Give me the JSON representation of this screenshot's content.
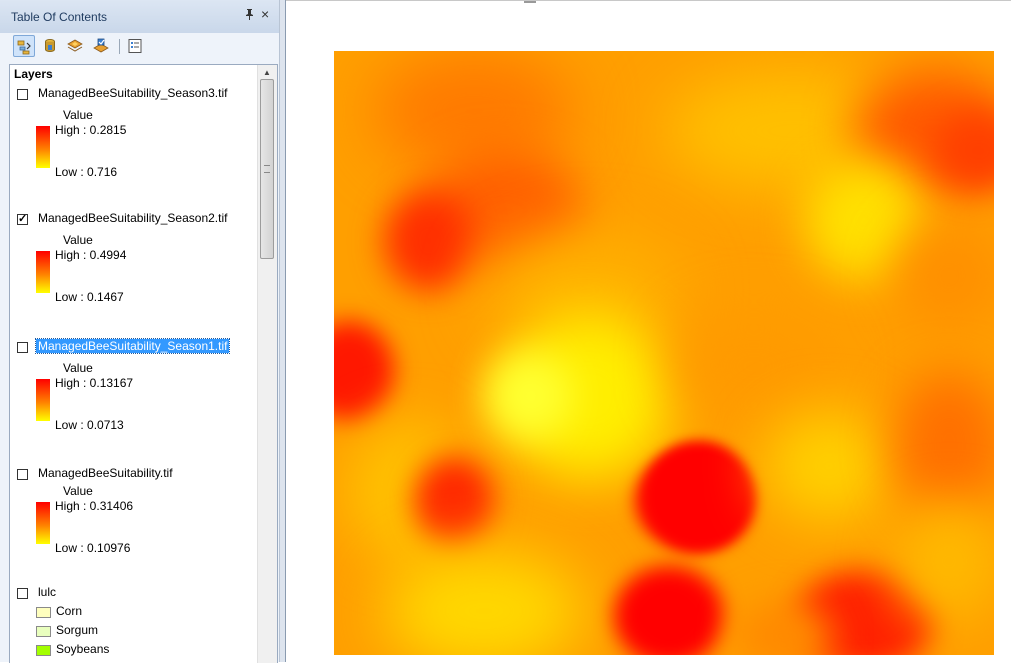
{
  "toc": {
    "title": "Table Of Contents",
    "pin_glyph": "ᵖ",
    "close_glyph": "×",
    "toolbar": [
      {
        "name": "list-by-drawing-order-icon",
        "active": true
      },
      {
        "name": "list-by-source-icon",
        "active": false
      },
      {
        "name": "list-by-visibility-icon",
        "active": false
      },
      {
        "name": "list-by-selection-icon",
        "active": false
      },
      {
        "name": "options-icon",
        "active": false
      }
    ],
    "root_label": "Layers",
    "layers": [
      {
        "name": "ManagedBeeSuitability_Season3.tif",
        "checked": false,
        "selected": false,
        "value_label": "Value",
        "high": "High : 0.2815",
        "low": "Low : 0.716"
      },
      {
        "name": "ManagedBeeSuitability_Season2.tif",
        "checked": true,
        "selected": false,
        "value_label": "Value",
        "high": "High : 0.4994",
        "low": "Low : 0.1467"
      },
      {
        "name": "ManagedBeeSuitability_Season1.tif",
        "checked": false,
        "selected": true,
        "value_label": "Value",
        "high": "High : 0.13167",
        "low": "Low : 0.0713"
      },
      {
        "name": "ManagedBeeSuitability.tif",
        "checked": false,
        "selected": false,
        "value_label": "Value",
        "high": "High : 0.31406",
        "low": "Low : 0.10976"
      }
    ],
    "lulc": {
      "name": "lulc",
      "checked": false,
      "classes": [
        {
          "label": "Corn",
          "color": "#ffffbe"
        },
        {
          "label": "Sorgum",
          "color": "#e9ffbe"
        },
        {
          "label": "Soybeans",
          "color": "#a3ff00"
        }
      ]
    }
  },
  "colors": {
    "ramp_high": "#ff0000",
    "ramp_mid": "#ff8000",
    "ramp_low": "#ffff00",
    "selection": "#3399ff"
  }
}
